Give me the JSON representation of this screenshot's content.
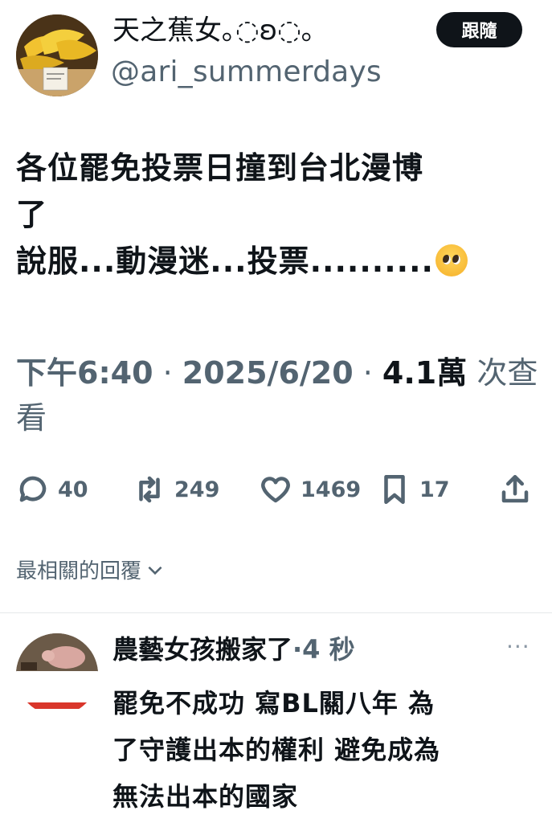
{
  "author": {
    "display_name": "天之蕉女｡◌ʚ◌｡",
    "handle": "@ari_summerdays",
    "follow_label": "跟隨"
  },
  "tweet": {
    "lines": [
      "各位罷免投票日撞到台北漫博",
      "了",
      "說服...動漫迷...投票.........."
    ],
    "emoji": "pleading-face",
    "time": "下午6:40",
    "date": "2025/6/20",
    "views_count": "4.1萬",
    "views_label_1": "次查",
    "views_label_2": "看"
  },
  "actions": {
    "replies": "40",
    "retweets": "249",
    "likes": "1469",
    "bookmarks": "17"
  },
  "replies_filter": {
    "label": "最相關的回覆"
  },
  "reply": {
    "name": "農藝女孩搬家了",
    "time_ago": "4 秒",
    "lines": [
      "罷免不成功 寫BL關八年 為",
      "了守護出本的權利 避免成為",
      "無法出本的國家"
    ],
    "more": "···"
  },
  "colors": {
    "text": "#0f1419",
    "secondary": "#536471",
    "follow_bg": "#0f1419"
  }
}
